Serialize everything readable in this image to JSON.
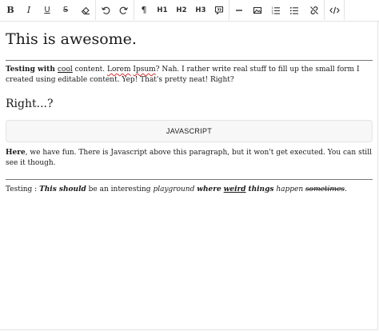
{
  "toolbar": {
    "buttons": [
      {
        "name": "bold-button",
        "label": "B"
      },
      {
        "name": "italic-button",
        "label": "I"
      },
      {
        "name": "underline-button",
        "label": "U"
      },
      {
        "name": "strikethrough-button",
        "label": "S"
      },
      {
        "name": "clear-format-button",
        "icon": "eraser-icon"
      },
      {
        "name": "undo-button",
        "icon": "undo-icon"
      },
      {
        "name": "redo-button",
        "icon": "redo-icon"
      },
      {
        "name": "paragraph-button",
        "label": "¶"
      },
      {
        "name": "h1-button",
        "label": "H1"
      },
      {
        "name": "h2-button",
        "label": "H2"
      },
      {
        "name": "h3-button",
        "label": "H3"
      },
      {
        "name": "quote-button",
        "icon": "quote-icon"
      },
      {
        "name": "horizontal-rule-button",
        "icon": "horizontal-rule-icon"
      },
      {
        "name": "image-button",
        "icon": "image-icon"
      },
      {
        "name": "ordered-list-button",
        "icon": "ordered-list-icon"
      },
      {
        "name": "unordered-list-button",
        "icon": "unordered-list-icon"
      },
      {
        "name": "unlink-button",
        "icon": "unlink-icon"
      },
      {
        "name": "code-view-button",
        "icon": "code-icon"
      }
    ]
  },
  "content": {
    "title": "This is awesome.",
    "para1": {
      "p1": "Testing with ",
      "p2": "cool",
      "p3": " content. ",
      "p4": "Lorem",
      "p5": " ",
      "p6": "Ipsum",
      "p7": "? Nah. I rather write real stuff to fill up the small form I created using editable content. Yep! That's pretty neat! Right?"
    },
    "subheading": "Right...?",
    "code_block": "JAVASCRIPT",
    "para2": {
      "p1": "Here",
      "p2": ", we have fun. There is Javascript above this paragraph, but it won't get executed. You can still see it though."
    },
    "para3": {
      "p1": "Testing : ",
      "p2": "This should",
      "p3": " be an ",
      "p4": "interesting",
      "p5": " ",
      "p6": "playground",
      "p7": " ",
      "p8": "where",
      "p9": " ",
      "p10": "weird",
      "p11": " ",
      "p12": "things",
      "p13": " ",
      "p14": "happen",
      "p15": " ",
      "p16": "sometimes",
      "p17": "."
    }
  }
}
